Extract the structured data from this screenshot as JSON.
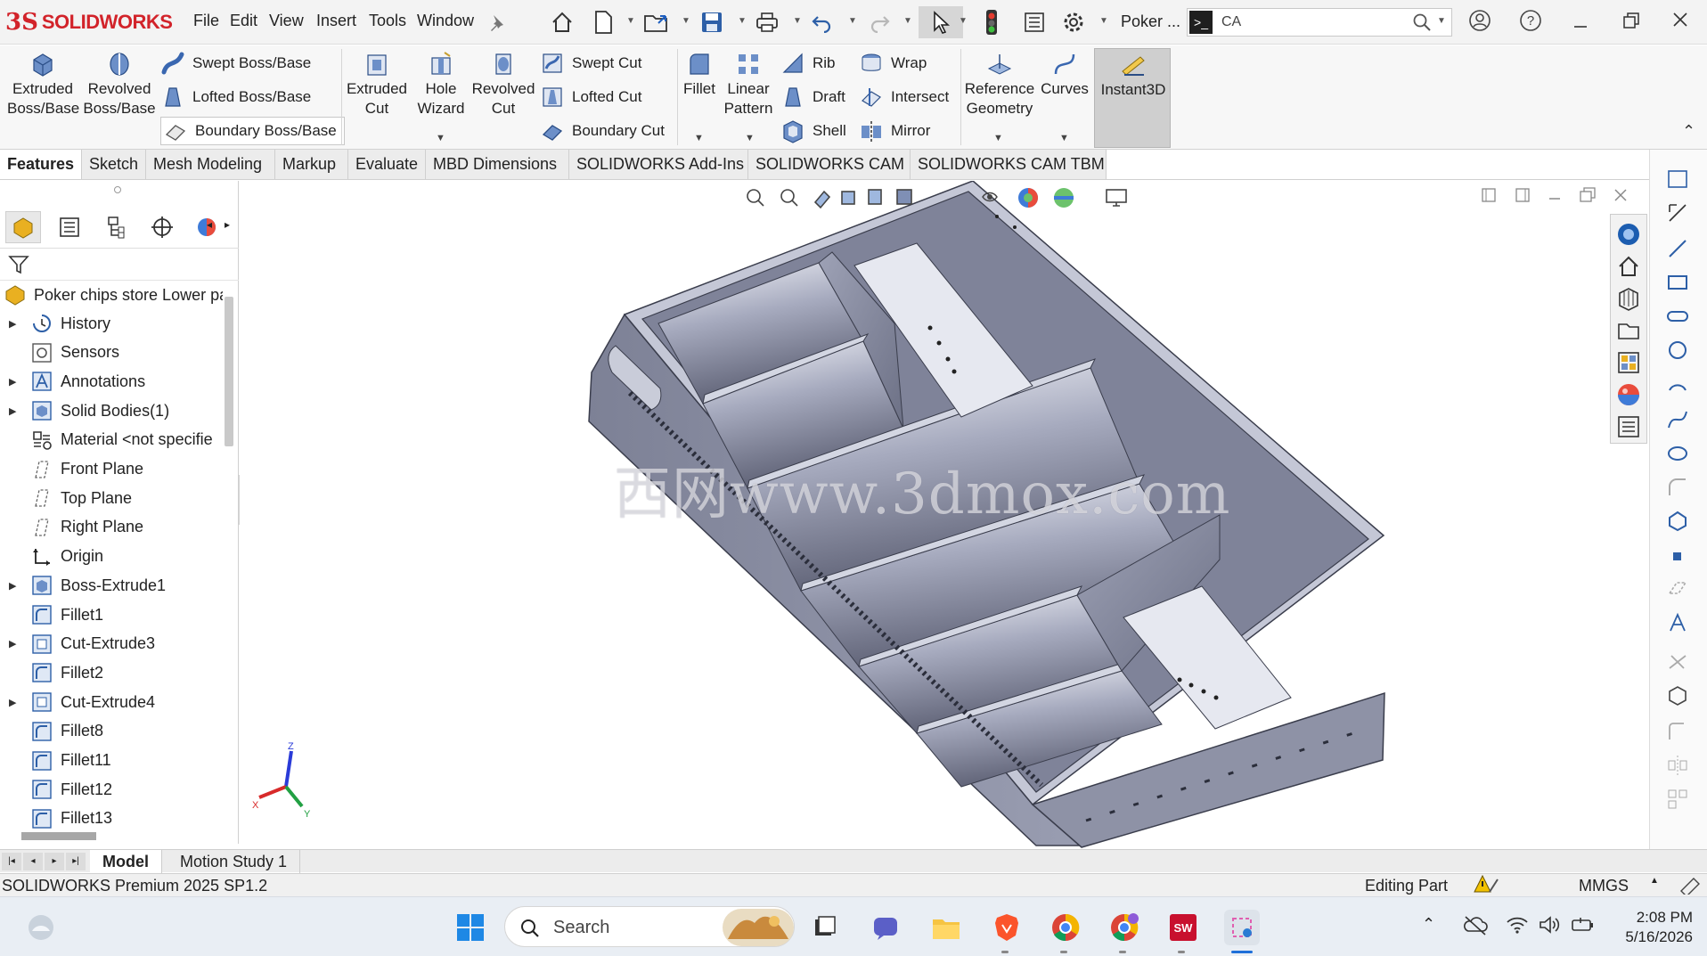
{
  "app": {
    "logo_mark": "3S",
    "logo_text": "SOLIDWORKS",
    "document_title": "Poker ...",
    "command_search": "CA",
    "menus": [
      "File",
      "Edit",
      "View",
      "Insert",
      "Tools",
      "Window"
    ]
  },
  "ribbon": {
    "extruded_boss": "Extruded\nBoss/Base",
    "revolved_boss": "Revolved\nBoss/Base",
    "swept_boss": "Swept Boss/Base",
    "lofted_boss": "Lofted Boss/Base",
    "boundary_boss": "Boundary Boss/Base",
    "extruded_cut": "Extruded\nCut",
    "hole_wizard": "Hole\nWizard",
    "revolved_cut": "Revolved\nCut",
    "swept_cut": "Swept Cut",
    "lofted_cut": "Lofted Cut",
    "boundary_cut": "Boundary Cut",
    "fillet": "Fillet",
    "linear_pattern": "Linear\nPattern",
    "rib": "Rib",
    "draft": "Draft",
    "shell": "Shell",
    "wrap": "Wrap",
    "intersect": "Intersect",
    "mirror": "Mirror",
    "reference_geometry": "Reference\nGeometry",
    "curves": "Curves",
    "instant3d": "Instant3D"
  },
  "tabs": [
    "Features",
    "Sketch",
    "Mesh Modeling",
    "Markup",
    "Evaluate",
    "MBD Dimensions",
    "SOLIDWORKS Add-Ins",
    "SOLIDWORKS CAM",
    "SOLIDWORKS CAM TBM"
  ],
  "feature_tree": {
    "root": "Poker chips store Lower pa",
    "items": [
      {
        "label": "History",
        "expandable": true,
        "icon": "history-icon"
      },
      {
        "label": "Sensors",
        "expandable": false,
        "icon": "sensors-icon"
      },
      {
        "label": "Annotations",
        "expandable": true,
        "icon": "annotations-icon"
      },
      {
        "label": "Solid Bodies(1)",
        "expandable": true,
        "icon": "solid-bodies-icon"
      },
      {
        "label": "Material <not specifie",
        "expandable": false,
        "icon": "material-icon"
      },
      {
        "label": "Front Plane",
        "expandable": false,
        "icon": "plane-icon"
      },
      {
        "label": "Top Plane",
        "expandable": false,
        "icon": "plane-icon"
      },
      {
        "label": "Right Plane",
        "expandable": false,
        "icon": "plane-icon"
      },
      {
        "label": "Origin",
        "expandable": false,
        "icon": "origin-icon"
      },
      {
        "label": "Boss-Extrude1",
        "expandable": true,
        "icon": "boss-extrude-icon"
      },
      {
        "label": "Fillet1",
        "expandable": false,
        "icon": "fillet-icon"
      },
      {
        "label": "Cut-Extrude3",
        "expandable": true,
        "icon": "cut-extrude-icon"
      },
      {
        "label": "Fillet2",
        "expandable": false,
        "icon": "fillet-icon"
      },
      {
        "label": "Cut-Extrude4",
        "expandable": true,
        "icon": "cut-extrude-icon"
      },
      {
        "label": "Fillet8",
        "expandable": false,
        "icon": "fillet-icon"
      },
      {
        "label": "Fillet11",
        "expandable": false,
        "icon": "fillet-icon"
      },
      {
        "label": "Fillet12",
        "expandable": false,
        "icon": "fillet-icon"
      },
      {
        "label": "Fillet13",
        "expandable": false,
        "icon": "fillet-icon"
      }
    ]
  },
  "viewport": {
    "watermark": "西网www.3dmox.com",
    "triad": {
      "x": "X",
      "y": "Y",
      "z": "Z"
    }
  },
  "bottom_tabs": [
    "Model",
    "Motion Study 1"
  ],
  "status": {
    "product": "SOLIDWORKS Premium 2025 SP1.2",
    "mode": "Editing Part",
    "units": "MMGS"
  },
  "taskbar": {
    "search": "Search",
    "time": "2:08 PM",
    "date": "5/16/2026"
  },
  "colors": {
    "brand": "#d2232a",
    "model_body": "#8f93a8",
    "ribbon_bg": "#f7f7f7"
  }
}
